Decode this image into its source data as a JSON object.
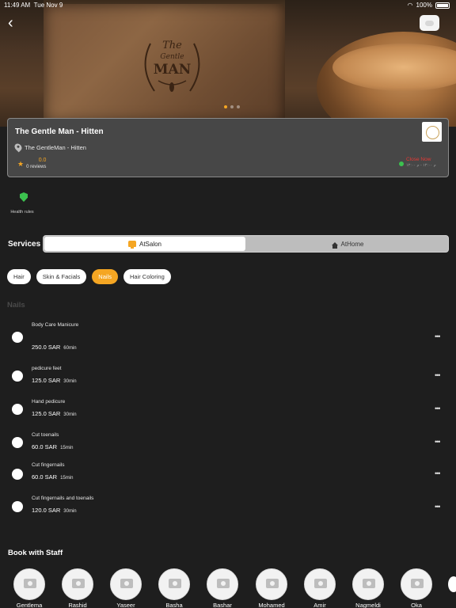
{
  "status_bar": {
    "time": "11:49 AM",
    "date": "Tue Nov 9",
    "battery": "100%"
  },
  "hero": {
    "logo_text_1": "The",
    "logo_text_2": "Gentle",
    "logo_text_3": "MAN",
    "carousel_active_index": 0,
    "carousel_count": 3
  },
  "salon": {
    "name": "The Gentle Man - Hitten",
    "location": "The GentleMan - Hitten",
    "rating": "0.0",
    "reviews": "0 reviews",
    "status": "Close Now",
    "hours": "م ١٢:٠٠ - م ١٢:٠٠"
  },
  "health": {
    "label": "Health rules"
  },
  "services": {
    "title": "Services",
    "at_salon": "AtSalon",
    "at_home": "AtHome",
    "categories": [
      "Hair",
      "Skin & Facials",
      "Nails",
      "Hair Coloring"
    ],
    "active_category": "Nails",
    "section_label": "Nails",
    "items": [
      {
        "name": "Body Care Manicure",
        "price": "250.0 SAR",
        "duration": "60min"
      },
      {
        "name": "pedicure feet",
        "price": "125.0 SAR",
        "duration": "30min"
      },
      {
        "name": "Hand pedicure",
        "price": "125.0 SAR",
        "duration": "30min"
      },
      {
        "name": "Cut toenails",
        "price": "60.0 SAR",
        "duration": "15min"
      },
      {
        "name": "Cut fingernails",
        "price": "60.0 SAR",
        "duration": "15min"
      },
      {
        "name": "Cut fingernails and toenails",
        "price": "120.0 SAR",
        "duration": "30min"
      }
    ],
    "more_label": "•••"
  },
  "staff": {
    "title": "Book with Staff",
    "members": [
      "Gentlema",
      "Rashid",
      "Yaseer",
      "Basha",
      "Bashar",
      "Mohamed",
      "Amir",
      "Nagmeldi",
      "Oka"
    ]
  },
  "colors": {
    "accent": "#f5a623",
    "background": "#1e1e1e",
    "open_dot": "#3cc14f",
    "closed_text": "#e53935"
  }
}
